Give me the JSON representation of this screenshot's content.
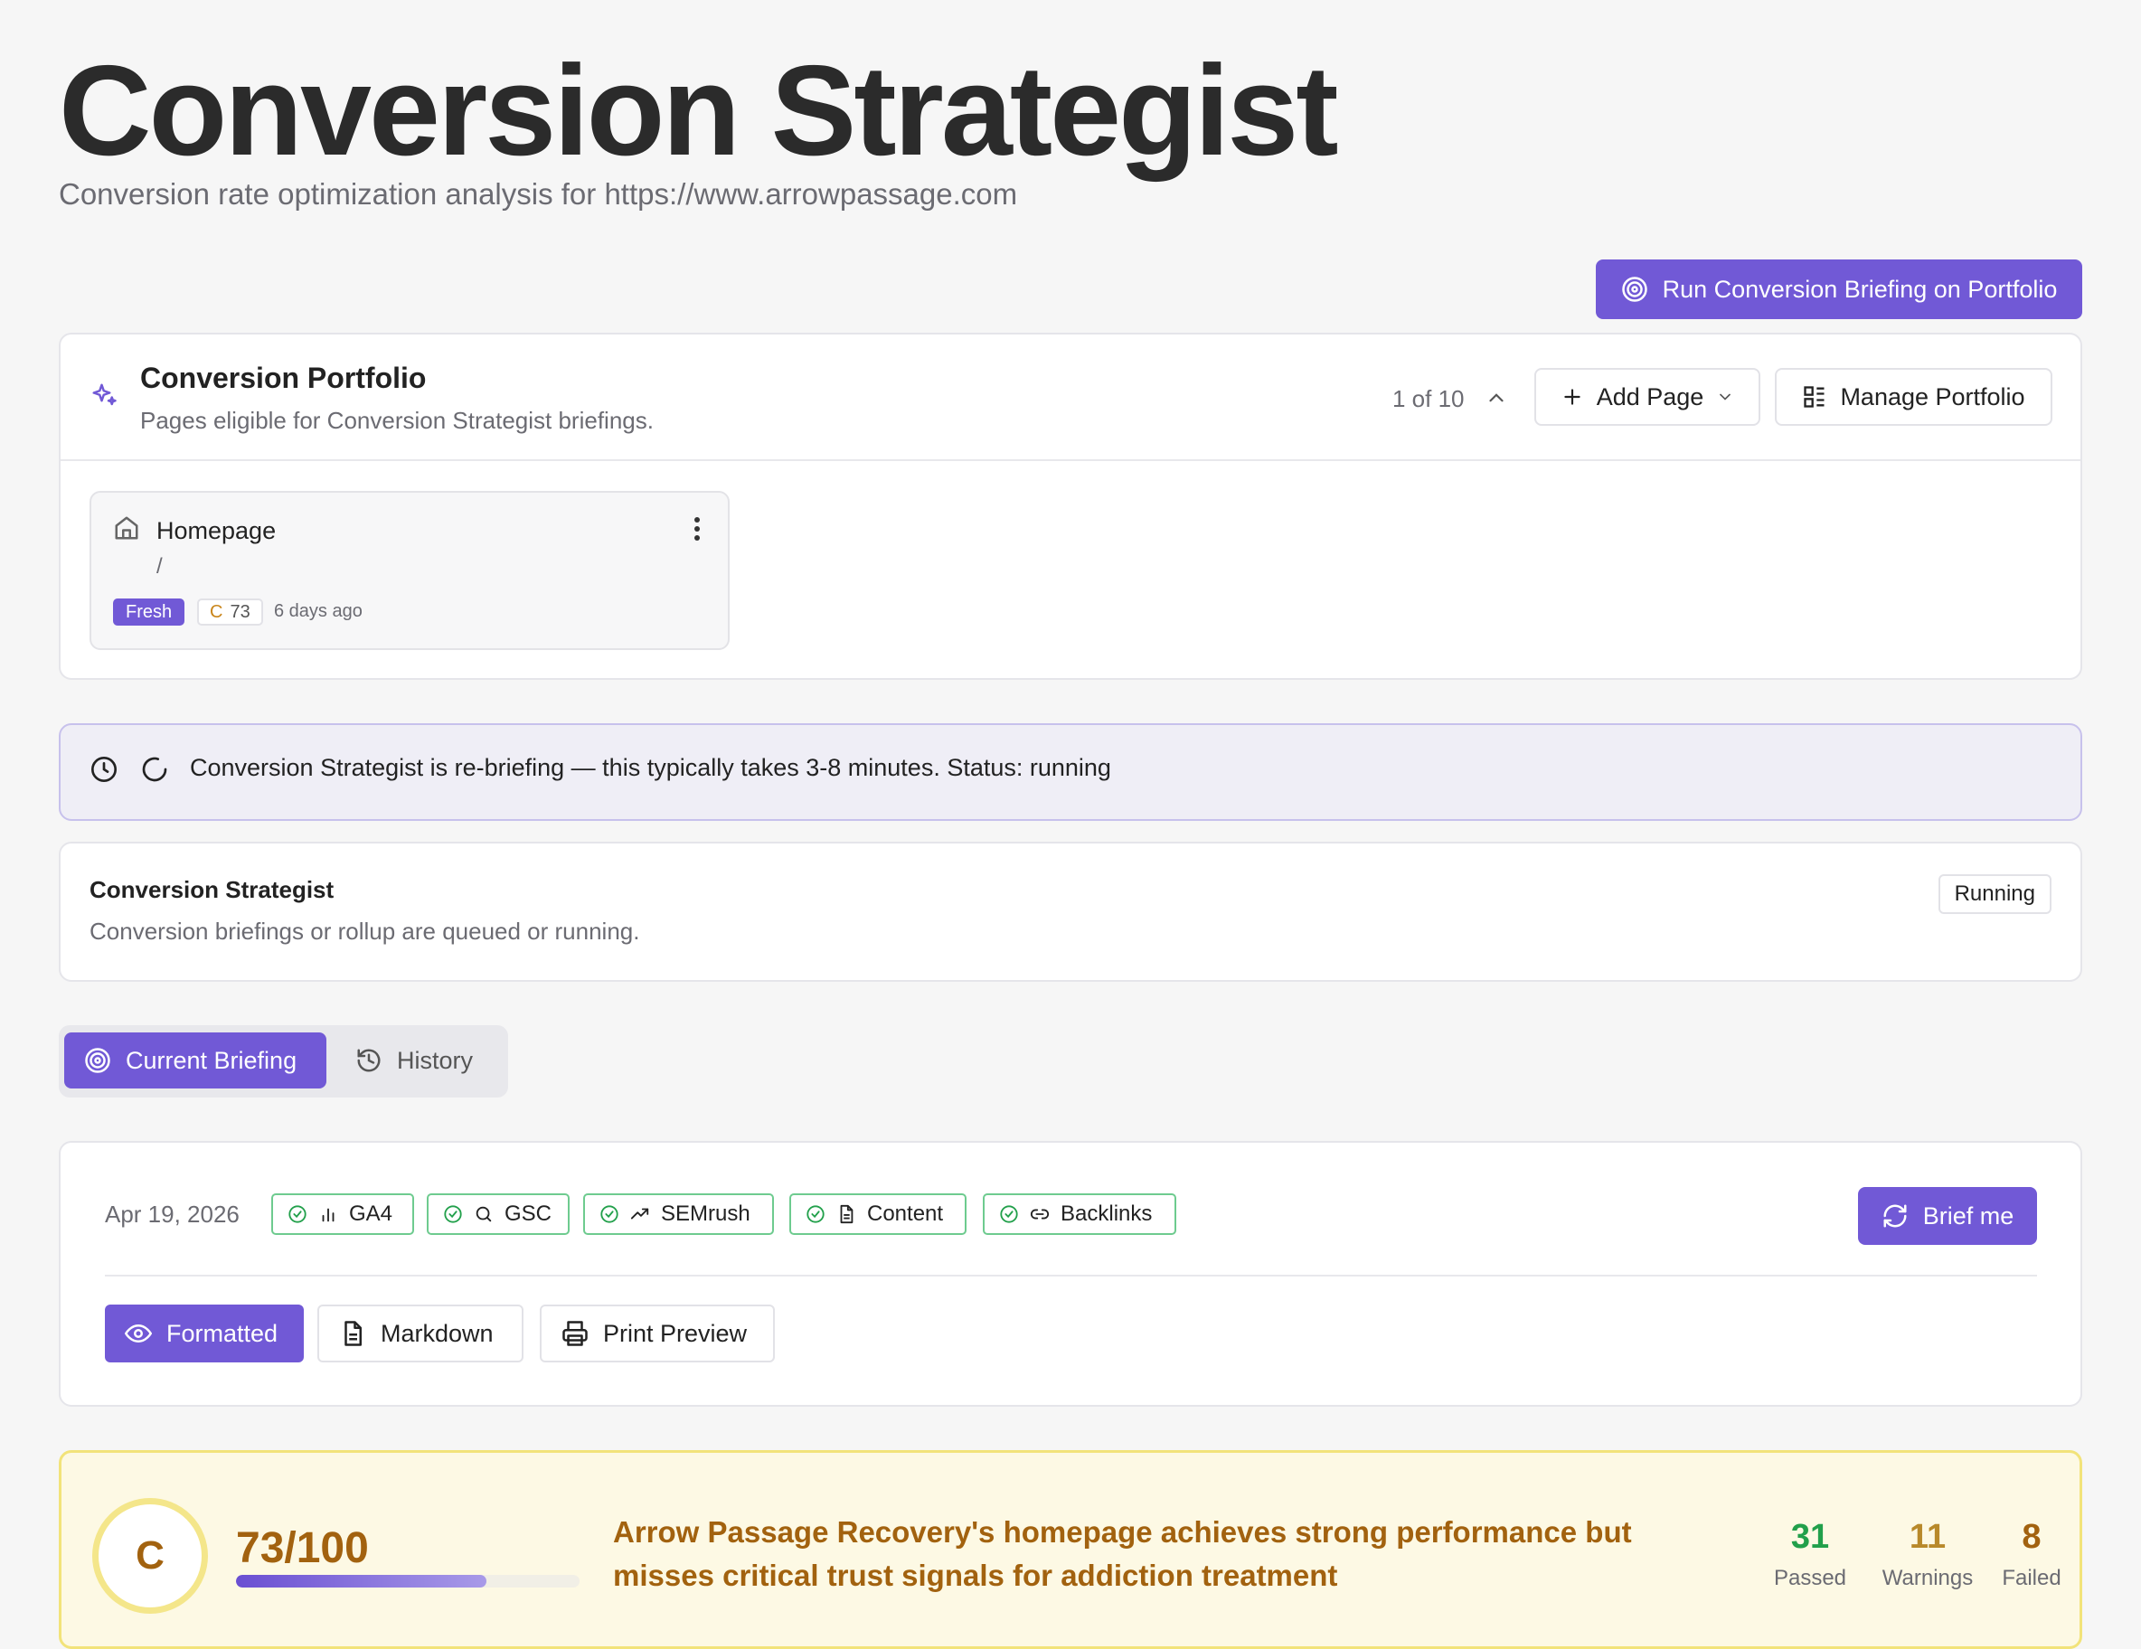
{
  "header": {
    "title": "Conversion Strategist",
    "subtitle": "Conversion rate optimization analysis for https://www.arrowpassage.com",
    "run_button": "Run Conversion Briefing on Portfolio"
  },
  "portfolio": {
    "title": "Conversion Portfolio",
    "description": "Pages eligible for Conversion Strategist briefings.",
    "count": "1 of 10",
    "add_page": "Add Page",
    "manage": "Manage Portfolio",
    "pages": [
      {
        "name": "Homepage",
        "path": "/",
        "status": "Fresh",
        "grade": "C",
        "score": "73",
        "age": "6 days ago"
      }
    ]
  },
  "banner": {
    "text": "Conversion Strategist is re-briefing — this typically takes 3-8 minutes. Status: running"
  },
  "job": {
    "title": "Conversion Strategist",
    "description": "Conversion briefings or rollup are queued or running.",
    "status": "Running"
  },
  "tabs": {
    "current": "Current Briefing",
    "history": "History"
  },
  "briefing": {
    "date": "Apr 19, 2026",
    "sources": [
      "GA4",
      "GSC",
      "SEMrush",
      "Content",
      "Backlinks"
    ],
    "brief_button": "Brief me",
    "views": {
      "formatted": "Formatted",
      "markdown": "Markdown",
      "print": "Print Preview"
    }
  },
  "score": {
    "grade": "C",
    "value": "73/100",
    "progress": 0.73,
    "headline": "Arrow Passage Recovery's homepage achieves strong performance but misses critical trust signals for addiction treatment",
    "stats": {
      "passed": {
        "value": "31",
        "label": "Passed",
        "color": "#22a04b"
      },
      "warnings": {
        "value": "11",
        "label": "Warnings",
        "color": "#b8892a"
      },
      "failed": {
        "value": "8",
        "label": "Failed",
        "color": "#a2620f"
      }
    }
  },
  "colors": {
    "accent": "#7159d6",
    "success": "#22a04b",
    "warning_bg": "#fdf9e4"
  }
}
